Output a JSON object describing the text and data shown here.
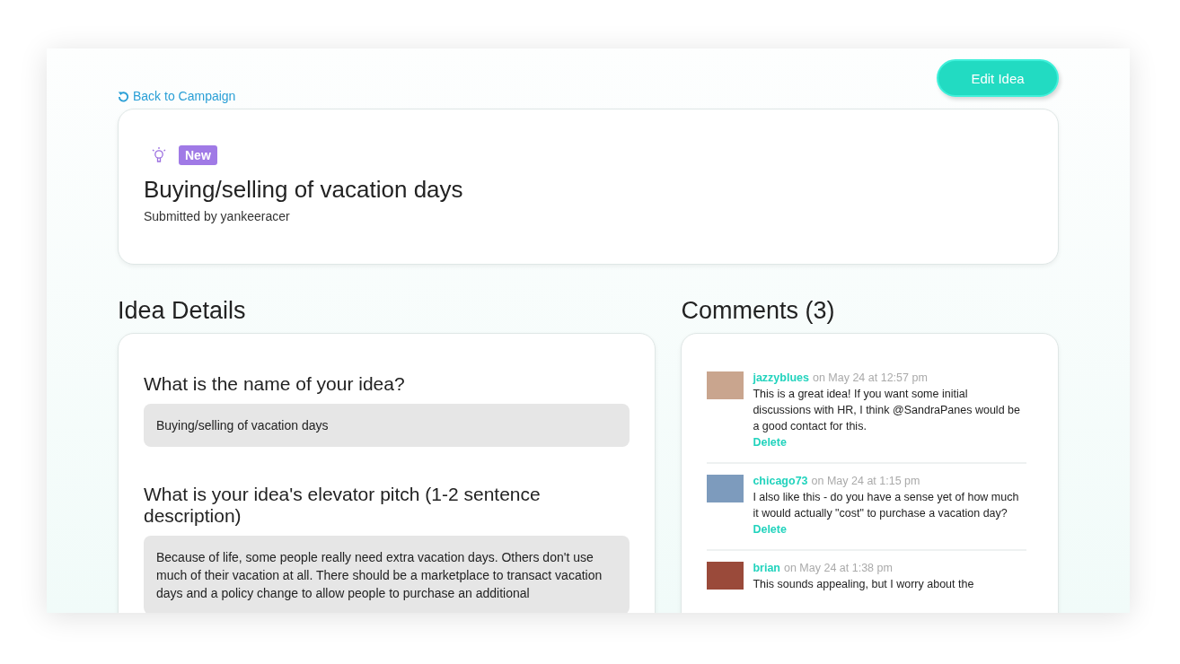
{
  "back_link": "Back to Campaign",
  "edit_button": "Edit Idea",
  "idea": {
    "status": "New",
    "title": "Buying/selling of vacation days",
    "submitted_by": "Submitted by yankeeracer"
  },
  "details": {
    "heading": "Idea Details",
    "questions": [
      {
        "question": "What is the name of your idea?",
        "answer": "Buying/selling of vacation days"
      },
      {
        "question": "What is your idea's elevator pitch (1-2 sentence description)",
        "answer": "Because of life, some people really need extra vacation days. Others don't use much of their vacation at all. There should be a marketplace to transact vacation days and a policy change to allow people to purchase an additional"
      }
    ]
  },
  "comments": {
    "heading": "Comments (3)",
    "items": [
      {
        "author": "jazzyblues",
        "time": "on May 24 at 12:57 pm",
        "text": "This is a great idea! If you want some initial discussions with HR, I think @SandraPanes would be a good contact for this.",
        "action": "Delete"
      },
      {
        "author": "chicago73",
        "time": "on May 24 at 1:15 pm",
        "text": "I also like this - do you have a sense yet of how much it would actually \"cost\" to purchase a vacation day?",
        "action": "Delete"
      },
      {
        "author": "brian",
        "time": "on May 24 at 1:38 pm",
        "text": "This sounds appealing, but I worry about the"
      }
    ]
  }
}
